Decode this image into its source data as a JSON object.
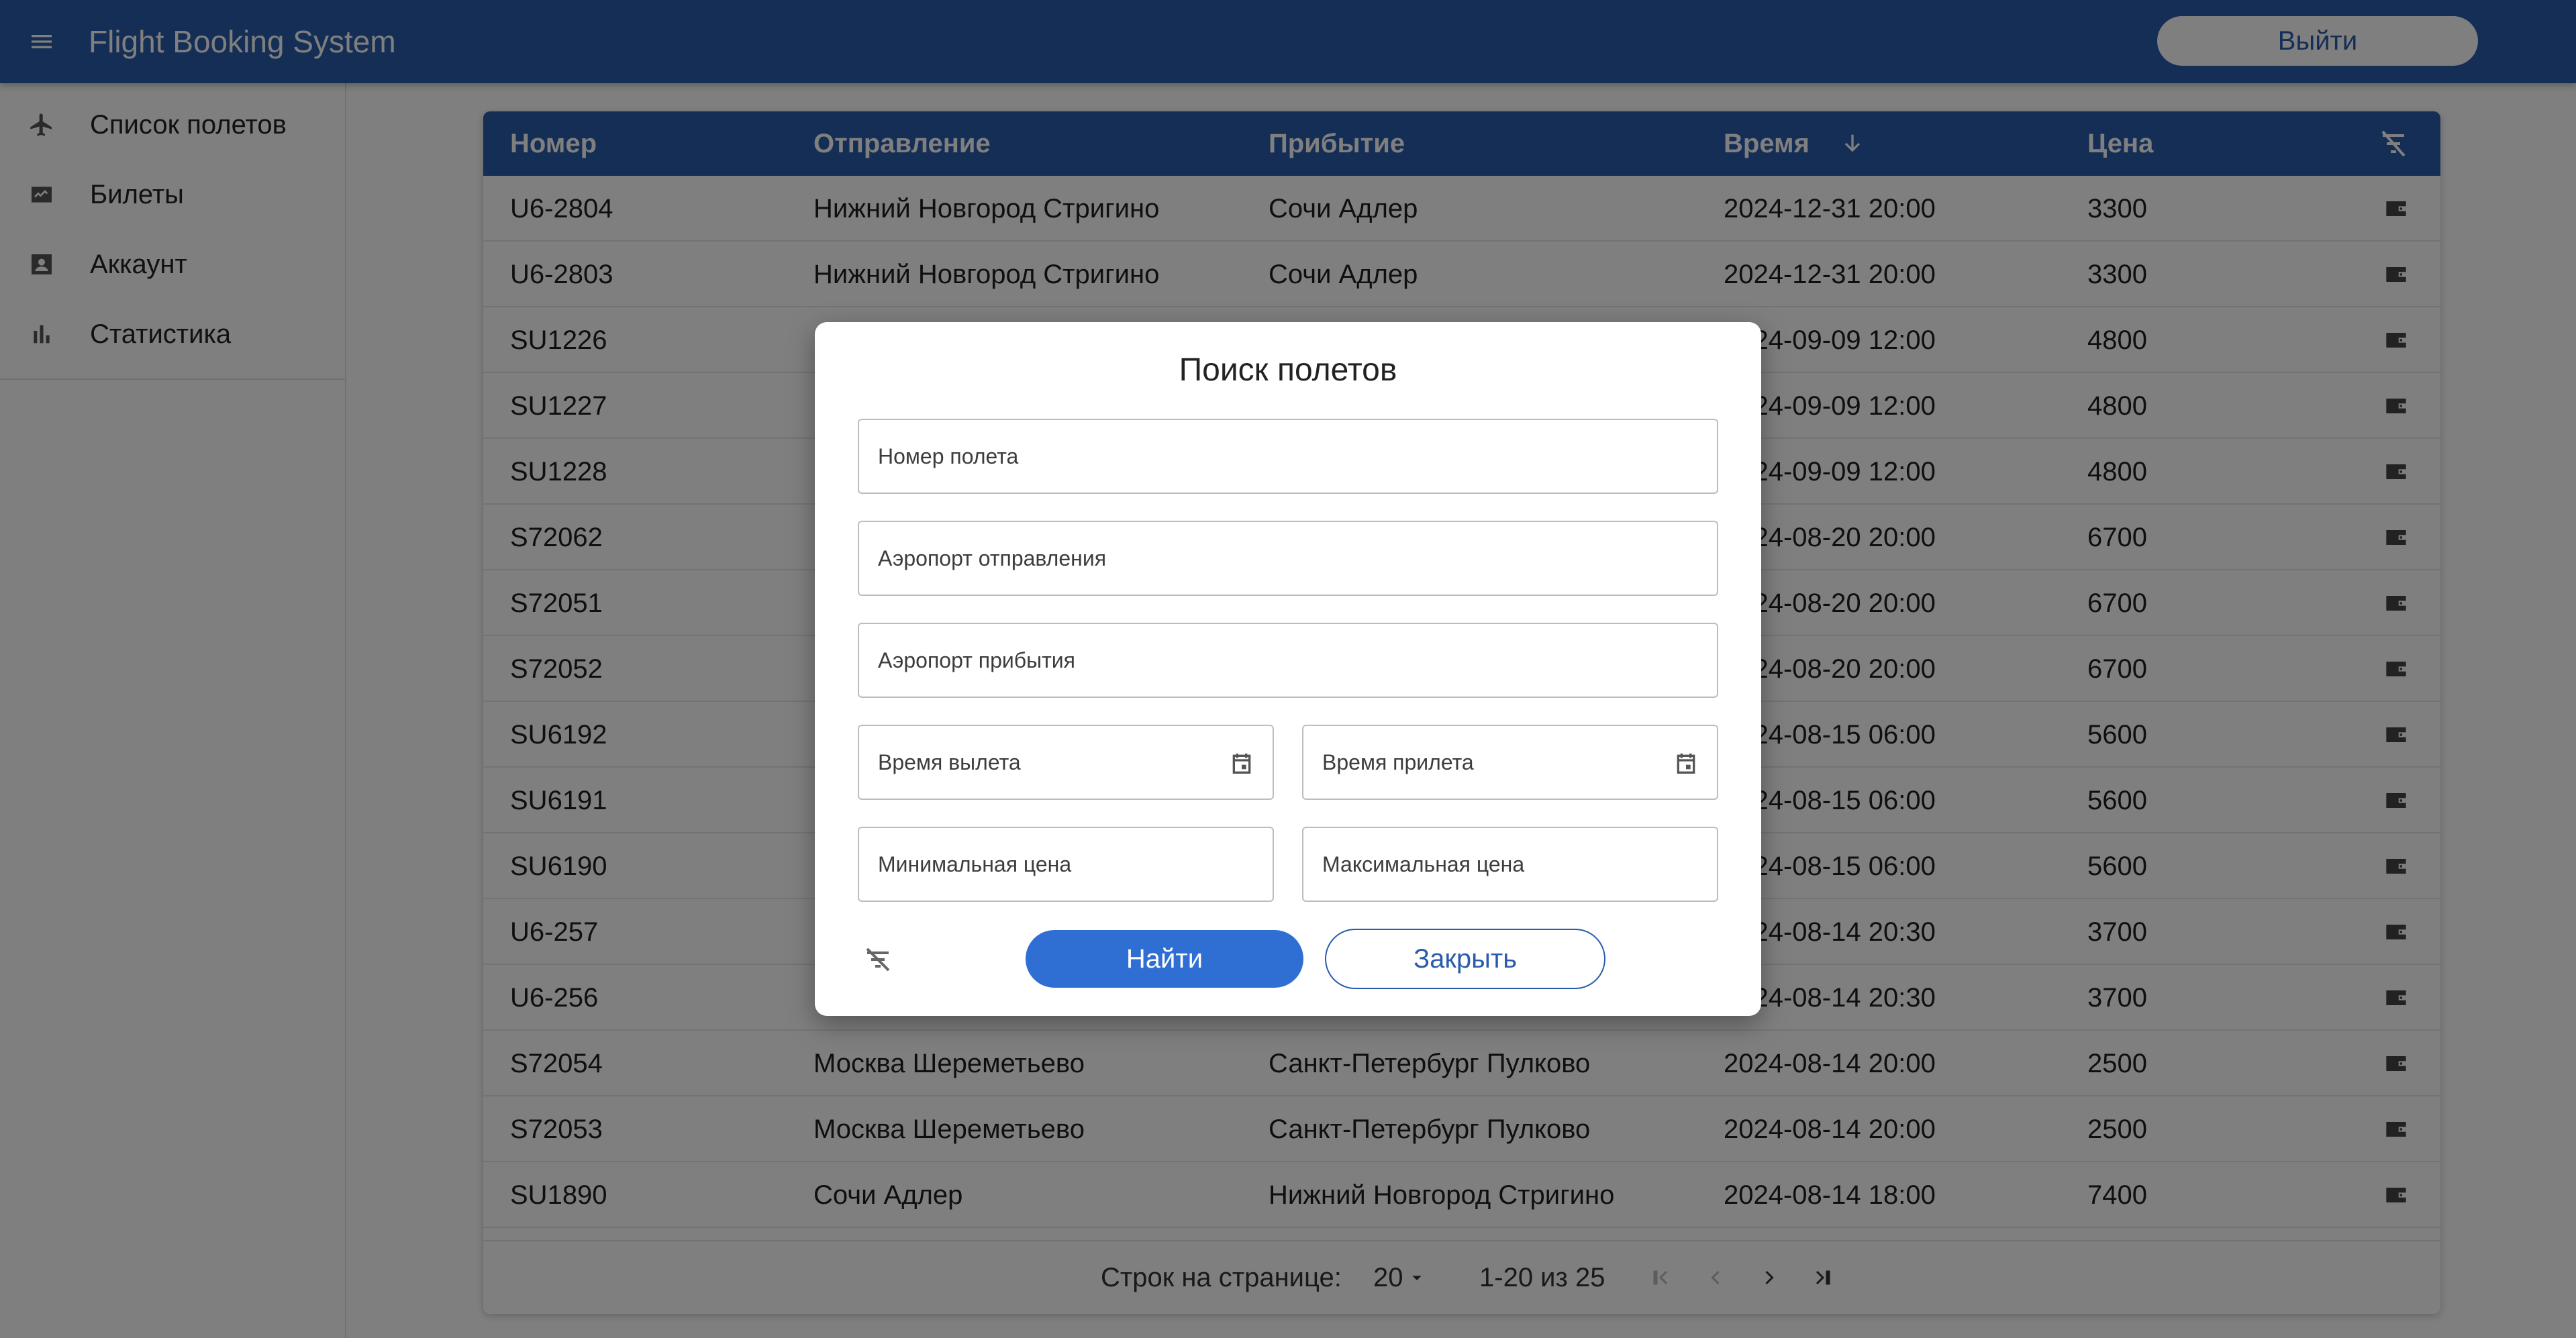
{
  "app": {
    "title": "Flight Booking System",
    "logout_label": "Выйти"
  },
  "sidebar": {
    "items": [
      {
        "label": "Список полетов",
        "icon": "airplane-icon"
      },
      {
        "label": "Билеты",
        "icon": "ticket-icon"
      },
      {
        "label": "Аккаунт",
        "icon": "account-box-icon"
      },
      {
        "label": "Статистика",
        "icon": "bar-chart-icon"
      }
    ]
  },
  "table": {
    "headers": {
      "number": "Номер",
      "departure": "Отправление",
      "arrival": "Прибытие",
      "time": "Время",
      "price": "Цена"
    },
    "sort": {
      "column": "time",
      "direction": "desc"
    },
    "rows": [
      {
        "number": "U6-2804",
        "departure": "Нижний Новгород Стригино",
        "arrival": "Сочи Адлер",
        "time": "2024-12-31 20:00",
        "price": "3300"
      },
      {
        "number": "U6-2803",
        "departure": "Нижний Новгород Стригино",
        "arrival": "Сочи Адлер",
        "time": "2024-12-31 20:00",
        "price": "3300"
      },
      {
        "number": "SU1226",
        "departure": "",
        "arrival": "",
        "time": "2024-09-09 12:00",
        "price": "4800"
      },
      {
        "number": "SU1227",
        "departure": "",
        "arrival": "",
        "time": "2024-09-09 12:00",
        "price": "4800"
      },
      {
        "number": "SU1228",
        "departure": "",
        "arrival": "",
        "time": "2024-09-09 12:00",
        "price": "4800"
      },
      {
        "number": "S72062",
        "departure": "",
        "arrival": "",
        "time": "2024-08-20 20:00",
        "price": "6700"
      },
      {
        "number": "S72051",
        "departure": "",
        "arrival": "",
        "time": "2024-08-20 20:00",
        "price": "6700"
      },
      {
        "number": "S72052",
        "departure": "",
        "arrival": "",
        "time": "2024-08-20 20:00",
        "price": "6700"
      },
      {
        "number": "SU6192",
        "departure": "",
        "arrival": "",
        "time": "2024-08-15 06:00",
        "price": "5600"
      },
      {
        "number": "SU6191",
        "departure": "",
        "arrival": "",
        "time": "2024-08-15 06:00",
        "price": "5600"
      },
      {
        "number": "SU6190",
        "departure": "",
        "arrival": "",
        "time": "2024-08-15 06:00",
        "price": "5600"
      },
      {
        "number": "U6-257",
        "departure": "",
        "arrival": "",
        "time": "2024-08-14 20:30",
        "price": "3700"
      },
      {
        "number": "U6-256",
        "departure": "",
        "arrival": "",
        "time": "2024-08-14 20:30",
        "price": "3700"
      },
      {
        "number": "S72054",
        "departure": "Москва Шереметьево",
        "arrival": "Санкт-Петербург Пулково",
        "time": "2024-08-14 20:00",
        "price": "2500"
      },
      {
        "number": "S72053",
        "departure": "Москва Шереметьево",
        "arrival": "Санкт-Петербург Пулково",
        "time": "2024-08-14 20:00",
        "price": "2500"
      },
      {
        "number": "SU1890",
        "departure": "Сочи Адлер",
        "arrival": "Нижний Новгород Стригино",
        "time": "2024-08-14 18:00",
        "price": "7400"
      }
    ]
  },
  "pagination": {
    "rows_per_page_label": "Строк на странице:",
    "rows_per_page": "20",
    "range": "1-20 из 25"
  },
  "dialog": {
    "title": "Поиск полетов",
    "flight_number_placeholder": "Номер полета",
    "departure_airport_placeholder": "Аэропорт отправления",
    "arrival_airport_placeholder": "Аэропорт прибытия",
    "departure_time_placeholder": "Время вылета",
    "arrival_time_placeholder": "Время прилета",
    "min_price_placeholder": "Минимальная цена",
    "max_price_placeholder": "Максимальная цена",
    "find_label": "Найти",
    "close_label": "Закрыть"
  },
  "colors": {
    "primary": "#2a5cad",
    "button": "#2f6fd4",
    "overlay": "rgba(0,0,0,0.5)"
  }
}
